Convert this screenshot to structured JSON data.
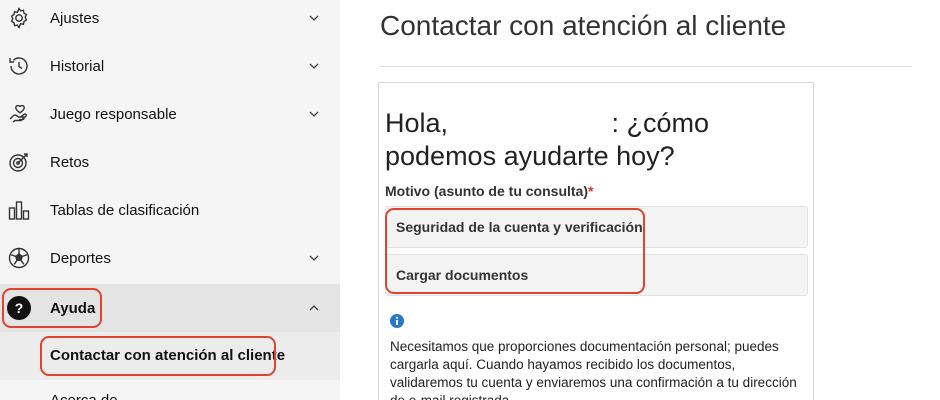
{
  "sidebar": {
    "items": [
      {
        "label": "Ajustes",
        "icon": "gear-icon",
        "has_chevron": true
      },
      {
        "label": "Historial",
        "icon": "history-icon",
        "has_chevron": true
      },
      {
        "label": "Juego responsable",
        "icon": "hand-heart-icon",
        "has_chevron": true
      },
      {
        "label": "Retos",
        "icon": "target-icon",
        "has_chevron": false
      },
      {
        "label": "Tablas de clasificación",
        "icon": "bar-chart-icon",
        "has_chevron": false
      },
      {
        "label": "Deportes",
        "icon": "soccer-ball-icon",
        "has_chevron": true
      },
      {
        "label": "Ayuda",
        "icon": "help-icon",
        "has_chevron": true,
        "expanded": true
      }
    ],
    "sub_item": {
      "label": "Contactar con atención al cliente"
    },
    "partial_item": {
      "label": "Acerca de"
    }
  },
  "main": {
    "title": "Contactar con atención al cliente",
    "greeting_start": "Hola,",
    "greeting_end": ": ¿cómo podemos ayudarte hoy?",
    "reason_label": "Motivo (asunto de tu consulta)",
    "required_mark": "*",
    "options": [
      {
        "label": "Seguridad de la cuenta y verificación"
      },
      {
        "label": "Cargar documentos"
      }
    ],
    "info_text": "Necesitamos que proporciones documentación personal; puedes cargarla aquí. Cuando hayamos recibido los documentos, validaremos tu cuenta y enviaremos una confirmación a tu dirección de e-mail registrada."
  },
  "colors": {
    "highlight": "#e0442f",
    "required": "#d9342b",
    "info": "#2a78c8",
    "sidebar_bg": "#f5f5f5",
    "active_bg": "#e4e4e4"
  }
}
